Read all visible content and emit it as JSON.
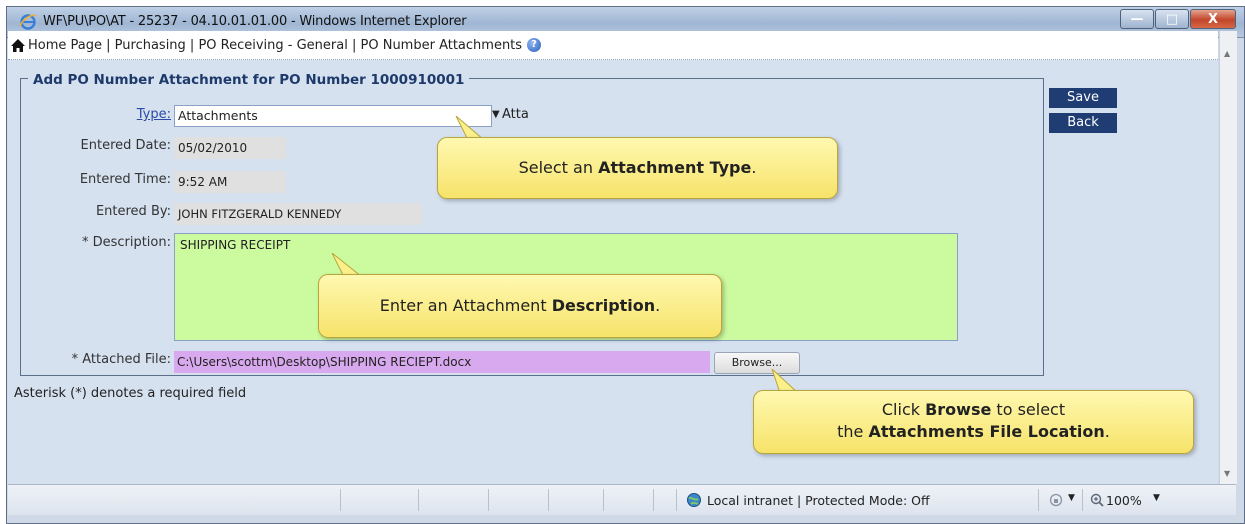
{
  "window": {
    "title": "WF\\PU\\PO\\AT - 25237 - 04.10.01.01.00 - Windows Internet Explorer",
    "minimize": "—",
    "maximize": "□",
    "close": "X"
  },
  "breadcrumb": {
    "home": "Home Page",
    "sep1": " | ",
    "purchasing": "Purchasing",
    "sep2": " | ",
    "receiving": "PO Receiving - General",
    "sep3": " | ",
    "current": "PO Number Attachments",
    "help": "?"
  },
  "form": {
    "legend": "Add PO Number Attachment for PO Number 1000910001",
    "type_label": "Type:",
    "type_value": "Attachments",
    "type_trailing": "Atta",
    "entered_date_label": "Entered Date:",
    "entered_date": "05/02/2010",
    "entered_time_label": "Entered Time:",
    "entered_time": "9:52 AM",
    "entered_by_label": "Entered By:",
    "entered_by": "JOHN FITZGERALD KENNEDY",
    "description_label": "* Description:",
    "description": "SHIPPING RECEIPT",
    "file_label": "* Attached File:",
    "file_path": "C:\\Users\\scottm\\Desktop\\SHIPPING RECIEPT.docx",
    "browse": "Browse...",
    "save": "Save",
    "back": "Back",
    "required_note": "Asterisk (*) denotes a required field"
  },
  "callouts": {
    "type_pre": "Select an ",
    "type_bold": "Attachment Type",
    "type_post": ".",
    "desc_pre": "Enter an Attachment ",
    "desc_bold": "Description",
    "desc_post": ".",
    "browse_pre": "Click ",
    "browse_bold1": "Browse",
    "browse_mid": " to select",
    "browse_pre2": "the ",
    "browse_bold2": "Attachments File Location",
    "browse_post": "."
  },
  "status": {
    "zone": "Local intranet | Protected Mode: Off",
    "zoom": "100%"
  },
  "colors": {
    "button_navy": "#1f3c73",
    "description_fill": "#ccfa9e",
    "file_fill": "#d8a9ee",
    "callout_yellow": "#f6e36a"
  }
}
